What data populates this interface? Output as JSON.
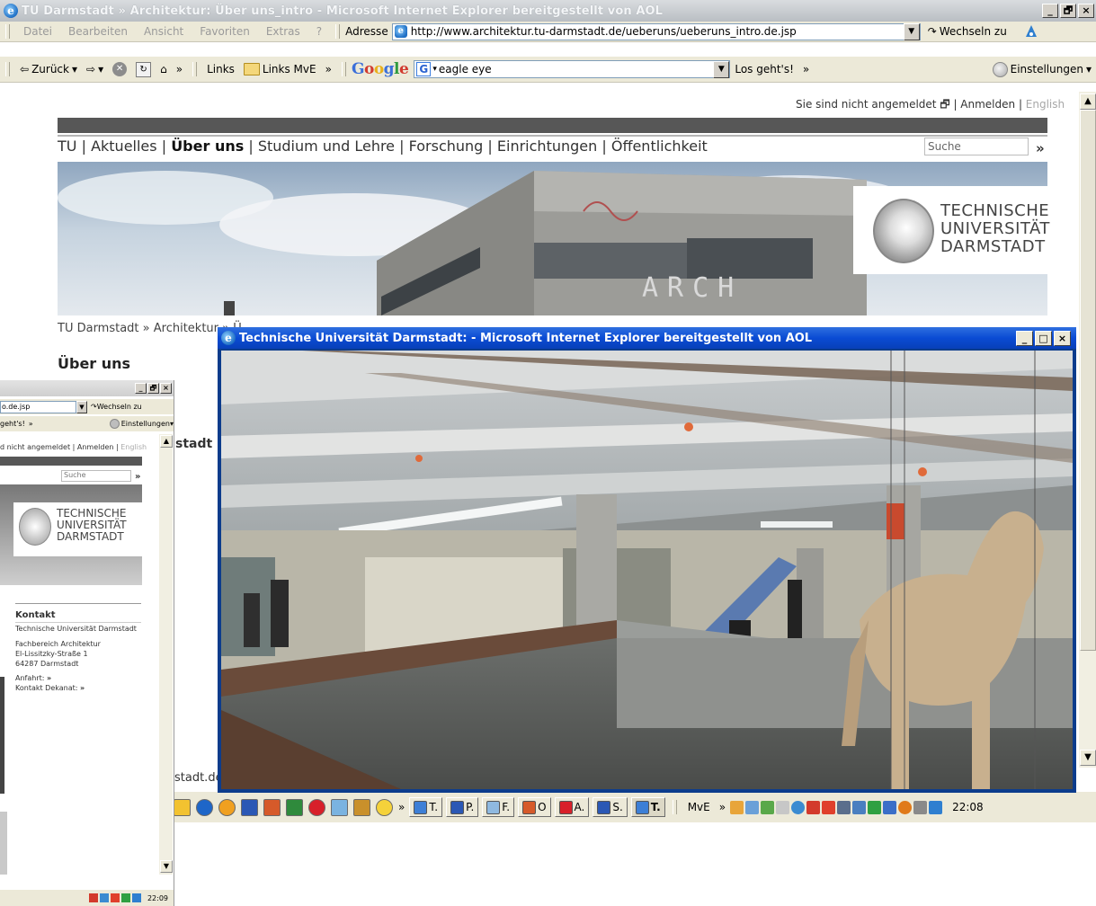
{
  "main_window": {
    "title": "TU Darmstadt » Architektur: Über uns_intro - Microsoft Internet Explorer bereitgestellt von AOL",
    "window_buttons": [
      "_",
      "🗗",
      "×"
    ]
  },
  "menu": {
    "items": [
      "Datei",
      "Bearbeiten",
      "Ansicht",
      "Favoriten",
      "Extras",
      "?"
    ],
    "address_label": "Adresse",
    "address_value": "http://www.architektur.tu-darmstadt.de/ueberuns/ueberuns_intro.de.jsp",
    "go_label": "Wechseln zu"
  },
  "toolbar": {
    "back_label": "Zurück",
    "more": "»",
    "links_label": "Links",
    "links_mve_label": "Links MvE",
    "google_label": "Google",
    "search_value": "eagle eye",
    "los_label": "Los geht's!",
    "settings_label": "Einstellungen"
  },
  "page": {
    "login_text": "Sie sind nicht angemeldet",
    "login_link": "Anmelden",
    "lang_link": "English",
    "nav": [
      "TU",
      "Aktuelles",
      "Über uns",
      "Studium und Lehre",
      "Forschung",
      "Einrichtungen",
      "Öffentlichkeit"
    ],
    "nav_separator": "|",
    "search_placeholder": "Suche",
    "search_go": "»",
    "logo_lines": [
      "TECHNISCHE",
      "UNIVERSITÄT",
      "DARMSTADT"
    ],
    "hero_sign": "ARCH",
    "breadcrumb": "TU Darmstadt » Architektur » Ü",
    "section_heading": "Über uns",
    "side_fragment": "stadt",
    "status_url_fragment": "stadt.de"
  },
  "small_window": {
    "address_fragment": "o.de.jsp",
    "go_label": "Wechseln zu",
    "los_fragment": "geht's!",
    "settings_label": "Einstellungen",
    "login_text": "d nicht angemeldet",
    "login_link": "Anmelden",
    "lang_link": "English",
    "search_placeholder": "Suche",
    "logo_lines": [
      "TECHNISCHE",
      "UNIVERSITÄT",
      "DARMSTADT"
    ],
    "contact_heading": "Kontakt",
    "contact_lines": [
      "Technische Universität Darmstadt",
      "Fachbereich Architektur",
      "El-Lissitzky-Straße 1",
      "64287 Darmstadt"
    ],
    "directions_label": "Anfahrt:",
    "dean_label": "Kontakt Dekanat:",
    "arrow": "»",
    "clock": "22:09"
  },
  "popup": {
    "title": "Technische Universität Darmstadt: - Microsoft Internet Explorer bereitgestellt von AOL",
    "window_buttons": [
      "_",
      "□",
      "×"
    ]
  },
  "taskbar": {
    "buttons": [
      "T.",
      "P.",
      "F.",
      "O",
      "A.",
      "S.",
      "T."
    ],
    "mve_label": "MvE",
    "more": "»",
    "clock": "22:08"
  }
}
